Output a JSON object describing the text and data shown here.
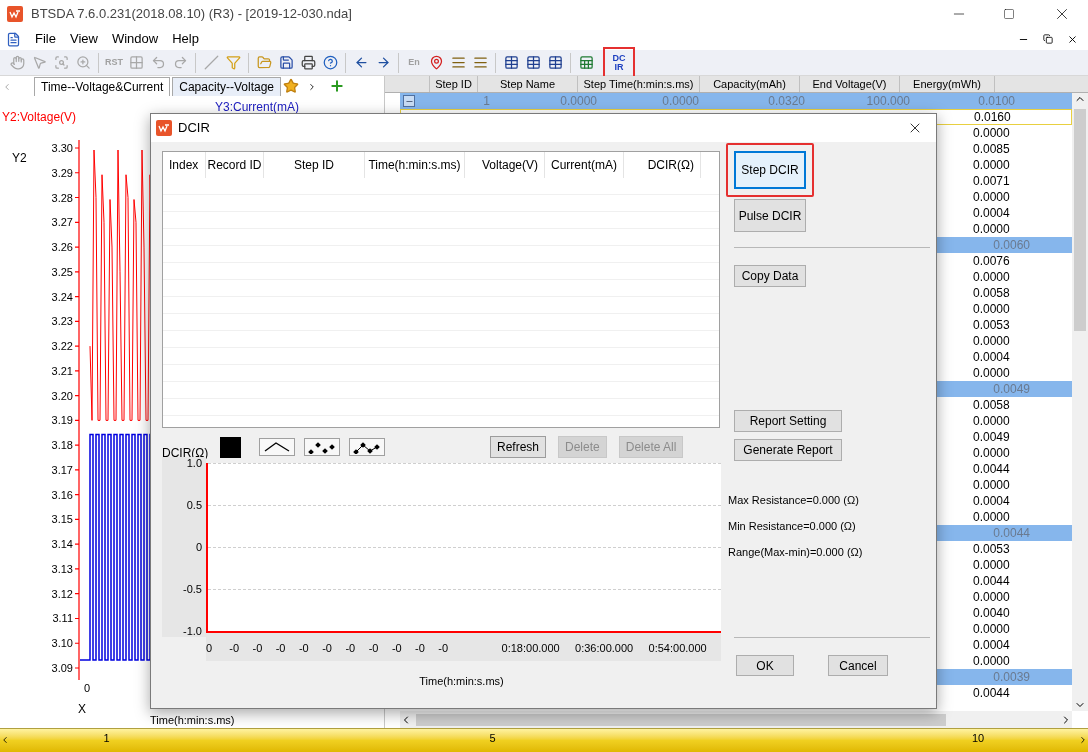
{
  "window": {
    "title": "BTSDA 7.6.0.231(2018.08.10) (R3) - [2019-12-030.nda]"
  },
  "menu": [
    "File",
    "View",
    "Window",
    "Help"
  ],
  "toolbar": [
    {
      "kind": "hand",
      "disabled": true
    },
    {
      "kind": "pointer",
      "disabled": true
    },
    {
      "kind": "zoom-box",
      "disabled": true
    },
    {
      "kind": "zoom",
      "disabled": true
    },
    {
      "kind": "sep"
    },
    {
      "kind": "text",
      "label": "RST",
      "disabled": true
    },
    {
      "kind": "grid",
      "disabled": true
    },
    {
      "kind": "undo",
      "disabled": true
    },
    {
      "kind": "redo",
      "disabled": true
    },
    {
      "kind": "sep"
    },
    {
      "kind": "line",
      "disabled": true
    },
    {
      "kind": "filter",
      "disabled": false
    },
    {
      "kind": "sep"
    },
    {
      "kind": "open",
      "disabled": false
    },
    {
      "kind": "save",
      "disabled": false
    },
    {
      "kind": "print",
      "disabled": false
    },
    {
      "kind": "help",
      "disabled": false
    },
    {
      "kind": "sep"
    },
    {
      "kind": "back",
      "disabled": false
    },
    {
      "kind": "forward",
      "disabled": false
    },
    {
      "kind": "sep"
    },
    {
      "kind": "text",
      "label": "En",
      "disabled": true
    },
    {
      "kind": "pin",
      "disabled": false
    },
    {
      "kind": "align",
      "disabled": false
    },
    {
      "kind": "align",
      "disabled": false
    },
    {
      "kind": "sep"
    },
    {
      "kind": "table",
      "disabled": false
    },
    {
      "kind": "table",
      "disabled": false
    },
    {
      "kind": "table",
      "disabled": false
    },
    {
      "kind": "sep"
    },
    {
      "kind": "excel",
      "disabled": false
    },
    {
      "kind": "text",
      "label": "DC IR",
      "disabled": false,
      "highlighted": true
    }
  ],
  "tabs": [
    {
      "label": "Time--Voltage&Current",
      "selected": true
    },
    {
      "label": "Capacity--Voltage",
      "selected": false
    }
  ],
  "left_chart": {
    "y2_title": "Y2:Voltage(V)",
    "y3_title": "Y3:Current(mA)",
    "y_axis_label": "Y2",
    "y_ticks": [
      "3.30",
      "3.29",
      "3.28",
      "3.27",
      "3.26",
      "3.25",
      "3.24",
      "3.23",
      "3.22",
      "3.21",
      "3.20",
      "3.19",
      "3.18",
      "3.17",
      "3.16",
      "3.15",
      "3.14",
      "3.13",
      "3.12",
      "3.11",
      "3.10",
      "3.09"
    ],
    "x_tick": "0",
    "x_axis_label": "X",
    "x_title": "Time(h:min:s.ms)"
  },
  "table": {
    "columns": [
      "Step ID",
      "Step Name",
      "Step Time(h:min:s.ms)",
      "Capacity(mAh)",
      "End Voltage(V)",
      "Energy(mWh)"
    ],
    "rows": [
      {
        "kind": "group",
        "expanded": true,
        "cells": [
          "1",
          "0.0000",
          "0.0000",
          "0.0320",
          "100.000",
          "0.0100"
        ]
      },
      {
        "kind": "data",
        "energy": "0.0160",
        "focused": true
      },
      {
        "kind": "data",
        "energy": "0.0000",
        "focused": false
      },
      {
        "kind": "data",
        "energy": "0.0085",
        "focused": false
      },
      {
        "kind": "data",
        "energy": "0.0000",
        "focused": false
      },
      {
        "kind": "data",
        "energy": "0.0071",
        "focused": false
      },
      {
        "kind": "data",
        "energy": "0.0000",
        "focused": false
      },
      {
        "kind": "data",
        "energy": "0.0004",
        "focused": false
      },
      {
        "kind": "data",
        "energy": "0.0000",
        "focused": false
      },
      {
        "kind": "group",
        "energy": "0.0060"
      },
      {
        "kind": "data",
        "energy": "0.0076",
        "focused": false
      },
      {
        "kind": "data",
        "energy": "0.0000",
        "focused": false
      },
      {
        "kind": "data",
        "energy": "0.0058",
        "focused": false
      },
      {
        "kind": "data",
        "energy": "0.0000",
        "focused": false
      },
      {
        "kind": "data",
        "energy": "0.0053",
        "focused": false
      },
      {
        "kind": "data",
        "energy": "0.0000",
        "focused": false
      },
      {
        "kind": "data",
        "energy": "0.0004",
        "focused": false
      },
      {
        "kind": "data",
        "energy": "0.0000",
        "focused": false
      },
      {
        "kind": "group",
        "energy": "0.0049"
      },
      {
        "kind": "data",
        "energy": "0.0058",
        "focused": false
      },
      {
        "kind": "data",
        "energy": "0.0000",
        "focused": false
      },
      {
        "kind": "data",
        "energy": "0.0049",
        "focused": false
      },
      {
        "kind": "data",
        "energy": "0.0000",
        "focused": false
      },
      {
        "kind": "data",
        "energy": "0.0044",
        "focused": false
      },
      {
        "kind": "data",
        "energy": "0.0000",
        "focused": false
      },
      {
        "kind": "data",
        "energy": "0.0004",
        "focused": false
      },
      {
        "kind": "data",
        "energy": "0.0000",
        "focused": false
      },
      {
        "kind": "group",
        "energy": "0.0044"
      },
      {
        "kind": "data",
        "energy": "0.0053",
        "focused": false
      },
      {
        "kind": "data",
        "energy": "0.0000",
        "focused": false
      },
      {
        "kind": "data",
        "energy": "0.0044",
        "focused": false
      },
      {
        "kind": "data",
        "energy": "0.0000",
        "focused": false
      },
      {
        "kind": "data",
        "energy": "0.0040",
        "focused": false
      },
      {
        "kind": "data",
        "energy": "0.0000",
        "focused": false
      },
      {
        "kind": "data",
        "energy": "0.0004",
        "focused": false
      },
      {
        "kind": "data",
        "energy": "0.0000",
        "focused": false
      },
      {
        "kind": "group",
        "energy": "0.0039"
      },
      {
        "kind": "data",
        "energy": "0.0044",
        "focused": false
      }
    ]
  },
  "dialog": {
    "title": "DCIR",
    "grid_columns": [
      "Index",
      "Record ID",
      "Step ID",
      "Time(h:min:s.ms)",
      "Voltage(V)",
      "Current(mA)",
      "DCIR(Ω)"
    ],
    "chart_label": "DCIR(Ω)",
    "style_buttons": [
      {
        "kind": "line"
      },
      {
        "kind": "points"
      },
      {
        "kind": "line-points"
      }
    ],
    "actions": [
      {
        "label": "Refresh",
        "disabled": false
      },
      {
        "label": "Delete",
        "disabled": true
      },
      {
        "label": "Delete All",
        "disabled": true
      }
    ],
    "y_ticks": [
      "1.0",
      "0.5",
      "0",
      "-0.5",
      "-1.0"
    ],
    "x_ticks": [
      "0",
      "-0",
      "-0",
      "-0",
      "-0",
      "-0",
      "-0",
      "-0",
      "-0",
      "-0",
      "-0",
      "0:18:00.000",
      "0:36:00.000",
      "0:54:00.000"
    ],
    "x_title": "Time(h:min:s.ms)",
    "mode_buttons": [
      {
        "label": "Step DCIR",
        "selected": true,
        "highlighted": true
      },
      {
        "label": "Pulse DCIR",
        "selected": false,
        "highlighted": false
      }
    ],
    "copy_button": "Copy Data",
    "report_buttons": [
      "Report Setting",
      "Generate Report"
    ],
    "stats": [
      "Max Resistance=0.000 (Ω)",
      "Min Resistance=0.000 (Ω)",
      "Range(Max-min)=0.000 (Ω)"
    ],
    "ok": "OK",
    "cancel": "Cancel"
  },
  "ruler": {
    "labels": [
      "1",
      "5",
      "10"
    ]
  }
}
